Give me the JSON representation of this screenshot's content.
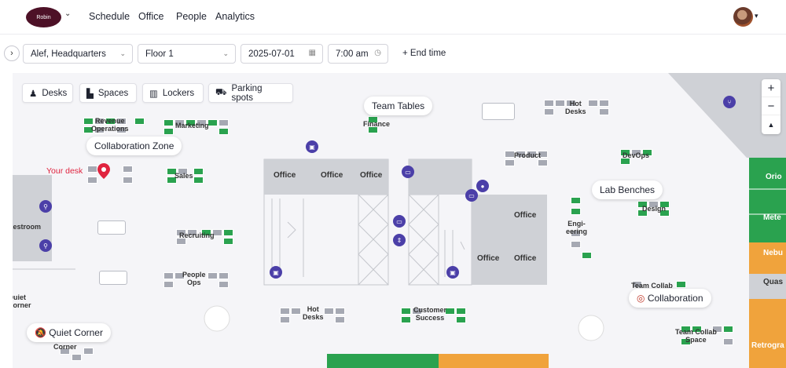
{
  "brand": {
    "logo_text": "Robin"
  },
  "nav": {
    "schedule": "Schedule",
    "office": "Office",
    "people": "People",
    "analytics": "Analytics"
  },
  "toolbar": {
    "location": "Alef, Headquarters",
    "floor": "Floor 1",
    "date": "2025-07-01",
    "time": "7:00 am",
    "end_time": "+ End time"
  },
  "filters": {
    "desks": "Desks",
    "spaces": "Spaces",
    "lockers": "Lockers",
    "parking": "Parking spots"
  },
  "bubbles": {
    "team_tables": "Team Tables",
    "collaboration_zone": "Collaboration Zone",
    "lab_benches": "Lab Benches",
    "collaboration": "Collaboration",
    "quiet_corner": "Quiet Corner"
  },
  "your_desk": "Your desk",
  "areas": {
    "revenue_ops": "Revenue\nOperations",
    "marketing": "Marketing",
    "finance": "Finance",
    "hot_desks_top": "Hot\nDesks",
    "product": "Product",
    "devops": "DevOps",
    "sales": "Sales",
    "design": "Design",
    "engineering": "Engi-\neering",
    "recruiting": "Recruiting",
    "people_ops": "People\nOps",
    "hot_desks_bottom": "Hot\nDesks",
    "customer_success": "Customer\nSuccess",
    "team_collab": "Team Collab",
    "team_collab_space": "Team Collab\nSpace",
    "restroom": "Restroom",
    "quiet_corner_left": "Quiet\nCorner",
    "corner": "Corner"
  },
  "offices": {
    "label": "Office"
  },
  "right_rooms": {
    "orion": "Orio",
    "meteor": "Mete",
    "nebula": "Nebu",
    "quasar": "Quas",
    "retrograde": "Retrogra"
  },
  "zoom": {
    "in": "+",
    "out": "−",
    "north": "▲"
  },
  "colors": {
    "available": "#2aa24f",
    "unavailable": "#a6a9b3",
    "orange": "#f0a33c",
    "brand": "#4d1127",
    "pin": "#4b3fa8"
  }
}
